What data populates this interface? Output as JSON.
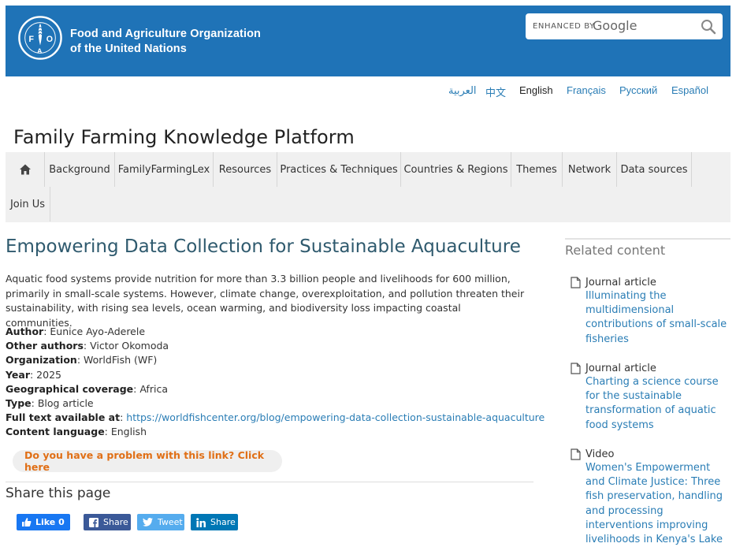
{
  "header": {
    "org_line1": "Food and Agriculture Organization",
    "org_line2": "of the United Nations",
    "logo_text": "FIAT PANIS",
    "search": {
      "enhanced_by": "ENHANCED BY",
      "engine": "Google",
      "icon": "search-icon"
    }
  },
  "languages": [
    "العربية",
    "中文",
    "English",
    "Français",
    "Русский",
    "Español"
  ],
  "active_language": "English",
  "site_title": "Family Farming Knowledge Platform",
  "nav": {
    "home_icon": "home-icon",
    "items": [
      "Background",
      "FamilyFarmingLex",
      "Resources",
      "Practices & Techniques",
      "Countries & Regions",
      "Themes",
      "Network",
      "Data sources",
      "Join Us"
    ]
  },
  "article": {
    "title": "Empowering Data Collection for Sustainable Aquaculture",
    "intro": "Aquatic food systems provide nutrition for more than 3.3 billion people and livelihoods for 600 million, primarily in small-scale systems. However, climate change, overexploitation, and pollution threaten their sustainability, with rising sea levels, ocean warming, and biodiversity loss impacting coastal communities.",
    "meta": [
      {
        "label": "Author",
        "value": "Eunice Ayo-Aderele"
      },
      {
        "label": "Other authors",
        "value": "Victor Okomoda"
      },
      {
        "label": "Organization",
        "value": "WorldFish (WF)"
      },
      {
        "label": "Year",
        "value": "2025"
      },
      {
        "label": "Geographical coverage",
        "value": "Africa"
      },
      {
        "label": "Type",
        "value": "Blog article"
      },
      {
        "label": "Full text available at",
        "value": "https://worldfishcenter.org/blog/empowering-data-collection-sustainable-aquaculture"
      },
      {
        "label": "Content language",
        "value": "English"
      }
    ],
    "problem_link": "Do you have a problem with this link? Click here"
  },
  "share": {
    "title": "Share this page",
    "like": "Like 0",
    "facebook": "Share",
    "twitter": "Tweet",
    "linkedin": "Share"
  },
  "sidebar": {
    "title": "Related content",
    "items": [
      {
        "type": "Journal article",
        "title": "Illuminating the multidimensional contributions of small-scale fisheries"
      },
      {
        "type": "Journal article",
        "title": "Charting a science course for the sustainable transformation of aquatic food systems"
      },
      {
        "type": "Video",
        "title": "Women's Empowerment and Climate Justice: Three fish preservation, handling and processing interventions improving livelihoods in Kenya's Lake Victoria region"
      }
    ]
  },
  "colors": {
    "header_bg": "#1f73b7",
    "link": "#2a7db5",
    "title": "#2f5a6e",
    "problem_link": "#e06f16",
    "facebook": "#3b5998",
    "twitter": "#55acee",
    "linkedin": "#0077b5",
    "like": "#1877f2"
  }
}
